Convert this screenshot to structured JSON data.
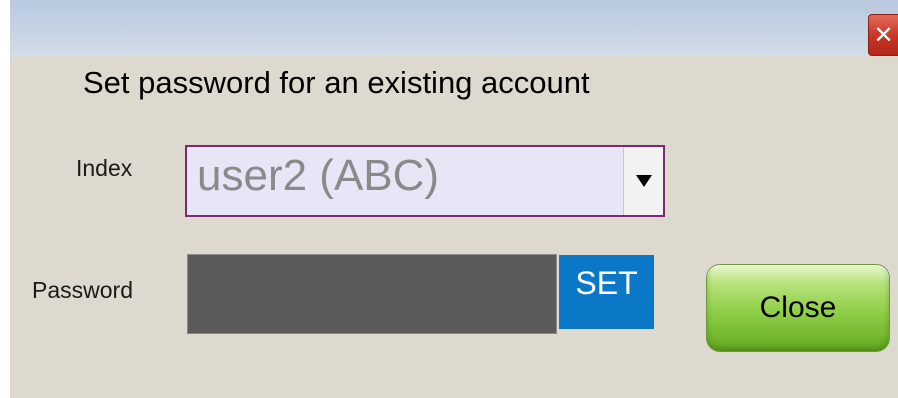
{
  "window": {
    "close_icon_glyph": "✕"
  },
  "dialog": {
    "heading": "Set password for an existing account",
    "index_label": "Index",
    "index_selected": "user2 (ABC)",
    "password_label": "Password",
    "password_value": "",
    "set_label": "SET",
    "close_label": "Close"
  },
  "colors": {
    "titlebar": "#c4d2e4",
    "body_bg": "#ddd9ce",
    "combo_border": "#7a2a72",
    "combo_bg": "#e6e6f6",
    "password_bg": "#5a5a5a",
    "set_button": "#0a78c6",
    "close_button": "#8fcf47",
    "window_close": "#c83324"
  },
  "icons": {
    "window_close": "close-icon",
    "dropdown": "triangle-down-icon"
  }
}
